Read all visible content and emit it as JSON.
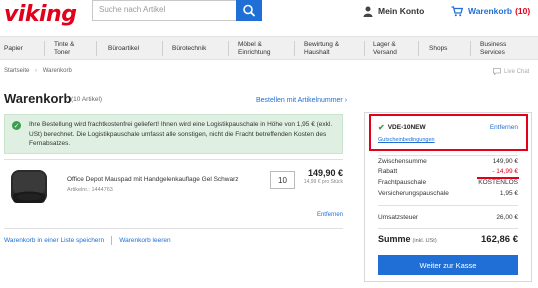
{
  "brand": {
    "logo_text": "viking",
    "accent": "#e2001a",
    "link_blue": "#1f6fd6",
    "success_green": "#3c9d4f"
  },
  "header": {
    "search_placeholder": "Suche nach Artikel",
    "account_label": "Mein Konto",
    "cart_label": "Warenkorb",
    "cart_count": "(10)"
  },
  "nav": {
    "items": [
      {
        "label": "Papier"
      },
      {
        "label": "Tinte & Toner"
      },
      {
        "label": "Büroartikel"
      },
      {
        "label": "Bürotechnik"
      },
      {
        "label": "Möbel & Einrichtung"
      },
      {
        "label": "Bewirtung & Haushalt"
      },
      {
        "label": "Lager & Versand"
      },
      {
        "label": "Shops"
      },
      {
        "label": "Business Services"
      }
    ]
  },
  "breadcrumb": {
    "home": "Startseite",
    "current": "Warenkorb"
  },
  "livechat": "Live Chat",
  "cart": {
    "title": "Warenkorb",
    "article_count": "(10 Artikel)",
    "add_by_number": "Bestellen mit Artikelnummer ›",
    "info_text": "Ihre Bestellung wird frachtkostenfrei geliefert! Ihnen wird eine Logistikpauschale in Höhe von 1,95 € (exkl. USt) berechnet. Die Logistikpauschale umfasst alle sonstigen, nicht die Fracht betreffenden Kosten des Fernabsatzes.",
    "product": {
      "name": "Office Depot Mauspad mit Handgelenkauflage Gel Schwarz",
      "artno": "Artikelnr.: 1444763",
      "quantity": "10",
      "price": "149,90 €",
      "unit_price": "14,99 € pro Stück",
      "remove": "Entfernen"
    },
    "save_list": "Warenkorb in einer Liste speichern",
    "empty_cart": "Warenkorb leeren"
  },
  "summary": {
    "voucher_code": "VDE-10NEW",
    "voucher_remove": "Entfernen",
    "voucher_terms": "Gutscheinbedingungen",
    "subtotal_label": "Zwischensumme",
    "subtotal_value": "149,90 €",
    "discount_label": "Rabatt",
    "discount_value": "- 14,99 €",
    "freight_label": "Frachtpauschale",
    "freight_value": "KOSTENLOS",
    "shipping_label": "Versicherungspauschale",
    "shipping_value": "1,95 €",
    "vat_label": "Umsatzsteuer",
    "vat_value": "26,00 €",
    "total_label": "Summe",
    "total_sub": "(inkl. USt)",
    "total_value": "162,86 €",
    "checkout_label": "Weiter zur Kasse"
  }
}
